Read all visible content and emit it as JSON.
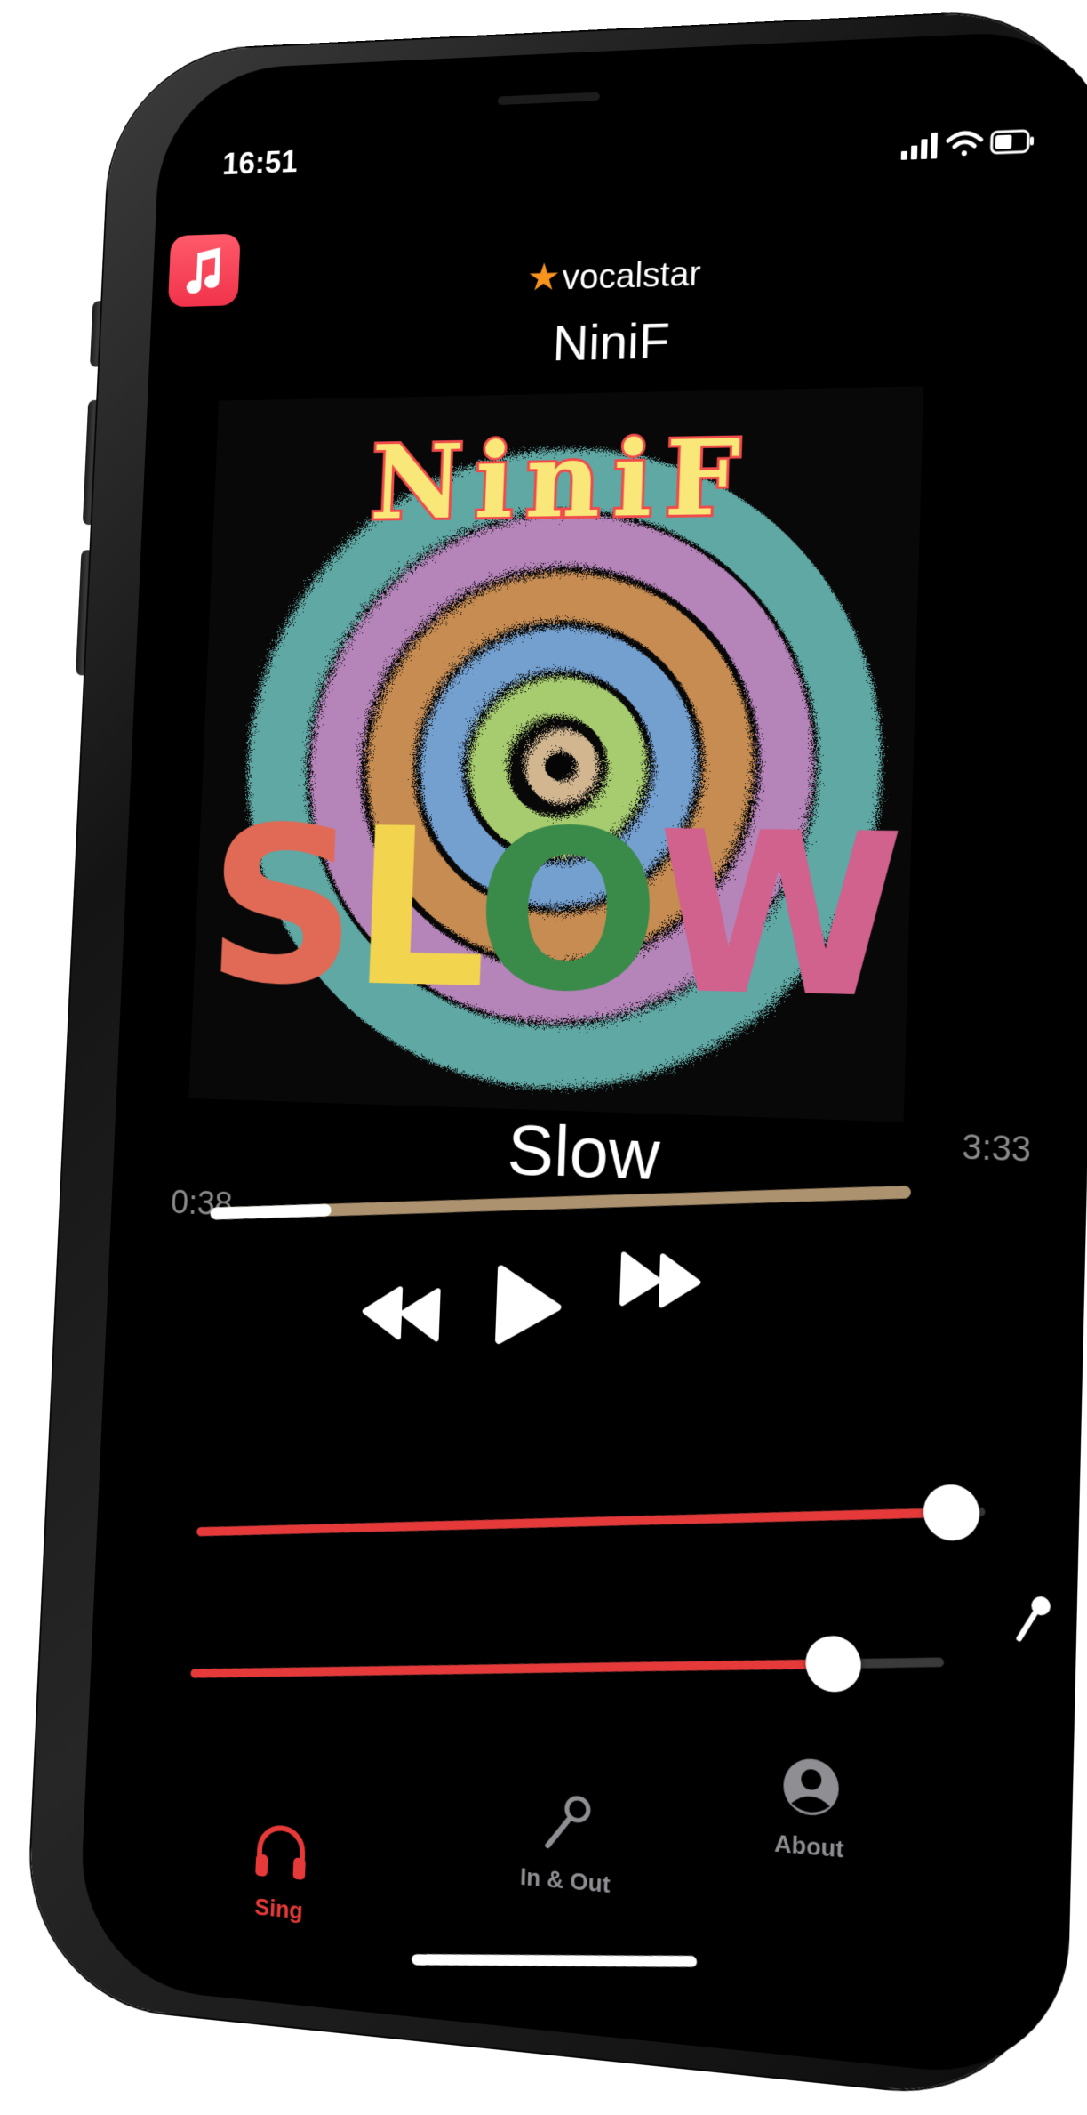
{
  "status_bar": {
    "time": "16:51"
  },
  "header": {
    "brand": "vocalstar",
    "artist": "NiniF"
  },
  "artwork": {
    "title_top": "NiniF",
    "title_bottom": [
      "S",
      "L",
      "O",
      "W"
    ]
  },
  "player": {
    "song_title": "Slow",
    "elapsed": "0:38",
    "duration": "3:33",
    "progress": 0.18
  },
  "controls": {
    "rewind_icon": "rewind-icon",
    "play_icon": "play-icon",
    "forward_icon": "fast-forward-icon"
  },
  "sliders": [
    {
      "name": "music-volume",
      "value": 0.96
    },
    {
      "name": "mic-volume",
      "value": 0.86
    }
  ],
  "tabs": [
    {
      "label": "Sing",
      "icon": "headphones-icon",
      "active": true
    },
    {
      "label": "In & Out",
      "icon": "microphone-icon",
      "active": false
    },
    {
      "label": "About",
      "icon": "person-circle-icon",
      "active": false
    }
  ],
  "colors": {
    "accent": "#e63a3a",
    "progress_track": "#ad9270",
    "tab_active": "#e63a3a",
    "tab_inactive": "#8e8e93"
  }
}
